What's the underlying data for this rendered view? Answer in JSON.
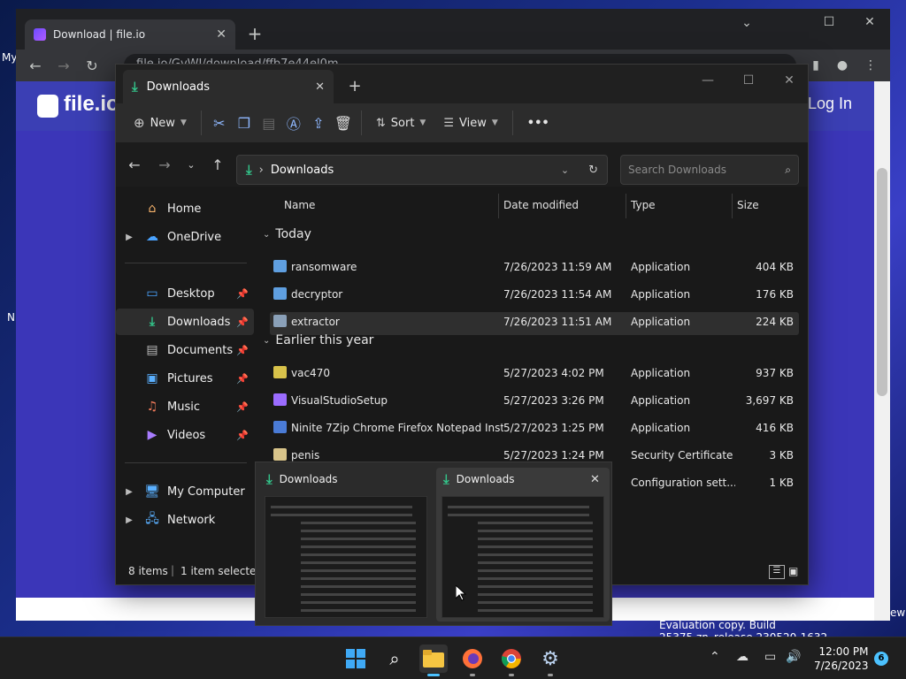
{
  "desktop": {
    "left_texts": [
      "My",
      "N"
    ],
    "right_text": "ew",
    "watermark": "Evaluation copy. Build 25375.zn_release.230520-1632"
  },
  "browser": {
    "tab_title": "Download | file.io",
    "url": "file.io/GvWI/download/ffb7e44el0m",
    "site": {
      "logo_text": "file.io",
      "login_label": "Log In"
    }
  },
  "explorer": {
    "tab_title": "Downloads",
    "toolbar": {
      "new_label": "New",
      "sort_label": "Sort",
      "view_label": "View",
      "more_label": "•••"
    },
    "address": {
      "path": "Downloads",
      "search_placeholder": "Search Downloads"
    },
    "sidebar": {
      "items": [
        {
          "label": "Home"
        },
        {
          "label": "OneDrive"
        },
        {
          "label": "Desktop"
        },
        {
          "label": "Downloads"
        },
        {
          "label": "Documents"
        },
        {
          "label": "Pictures"
        },
        {
          "label": "Music"
        },
        {
          "label": "Videos"
        },
        {
          "label": "My Computer"
        },
        {
          "label": "Network"
        }
      ]
    },
    "columns": {
      "name": "Name",
      "date": "Date modified",
      "type": "Type",
      "size": "Size"
    },
    "groups": {
      "today": "Today",
      "earlier": "Earlier this year"
    },
    "files": [
      {
        "name": "ransomware",
        "date": "7/26/2023 11:59 AM",
        "type": "Application",
        "size": "404 KB"
      },
      {
        "name": "decryptor",
        "date": "7/26/2023 11:54 AM",
        "type": "Application",
        "size": "176 KB"
      },
      {
        "name": "extractor",
        "date": "7/26/2023 11:51 AM",
        "type": "Application",
        "size": "224 KB"
      },
      {
        "name": "vac470",
        "date": "5/27/2023 4:02 PM",
        "type": "Application",
        "size": "937 KB"
      },
      {
        "name": "VisualStudioSetup",
        "date": "5/27/2023 3:26 PM",
        "type": "Application",
        "size": "3,697 KB"
      },
      {
        "name": "Ninite 7Zip Chrome Firefox Notepad Inst...",
        "date": "5/27/2023 1:25 PM",
        "type": "Application",
        "size": "416 KB"
      },
      {
        "name": "penis",
        "date": "5/27/2023 1:24 PM",
        "type": "Security Certificate",
        "size": "3 KB"
      },
      {
        "name": "",
        "date": "",
        "type": "Configuration sett...",
        "size": "1 KB"
      }
    ],
    "status": {
      "items": "8 items",
      "selected": "1 item selected"
    }
  },
  "thumbnails": [
    {
      "title": "Downloads"
    },
    {
      "title": "Downloads"
    }
  ],
  "taskbar": {
    "time": "12:00 PM",
    "date": "7/26/2023",
    "notification_count": "6"
  }
}
